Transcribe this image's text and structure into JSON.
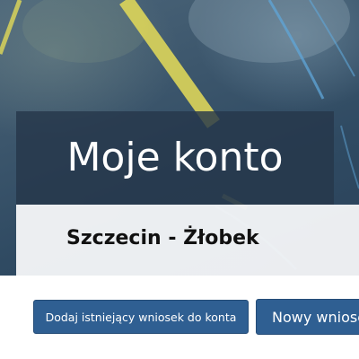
{
  "header": {
    "title": "Moje konto",
    "subtitle": "Szczecin - Żłobek"
  },
  "actions": {
    "add_existing_label": "Dodaj istniejący wniosek do konta",
    "new_application_label": "Nowy wniosek"
  },
  "colors": {
    "button": "#2f5f92",
    "title_overlay": "#26374a",
    "subtitle_overlay": "#f4f5f7",
    "hero_stripe": "#d9d35a"
  },
  "icons": {
    "hero_background": "chalkboard-image"
  }
}
